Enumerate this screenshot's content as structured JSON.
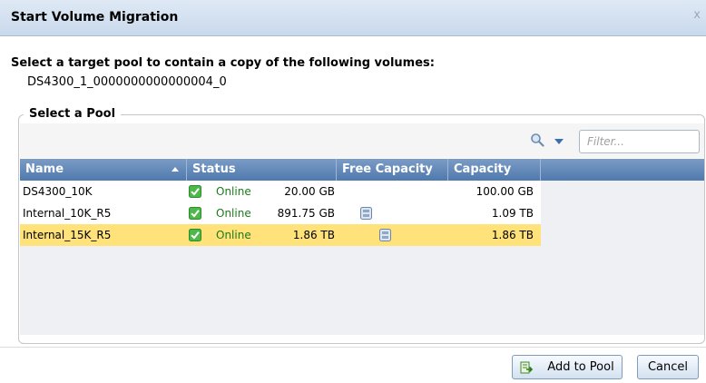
{
  "dialog": {
    "title": "Start Volume Migration",
    "close_label": "x"
  },
  "instruction": "Select a target pool to contain a copy of the following volumes:",
  "volume": "DS4300_1_0000000000000004_0",
  "pool_section": {
    "legend": "Select a Pool",
    "filter_placeholder": "Filter...",
    "icons": {
      "search": "search-icon",
      "menu": "chevron-down-icon"
    }
  },
  "table": {
    "columns": [
      "Name",
      "Status",
      "Free Capacity",
      "Capacity"
    ],
    "rows": [
      {
        "name": "DS4300_10K",
        "status": "Online",
        "free_capacity": "20.00 GB",
        "capacity": "100.00 GB",
        "free_icon": false,
        "selected": false
      },
      {
        "name": "Internal_10K_R5",
        "status": "Online",
        "free_capacity": "891.75 GB",
        "capacity": "1.09 TB",
        "free_icon": true,
        "selected": false
      },
      {
        "name": "Internal_15K_R5",
        "status": "Online",
        "free_capacity": "1.86 TB",
        "capacity": "1.86 TB",
        "free_icon": true,
        "selected": true
      }
    ]
  },
  "buttons": {
    "add": "Add to Pool",
    "cancel": "Cancel"
  },
  "colors": {
    "selected_row": "#ffe27a",
    "header": "#4f79ad",
    "online": "#1c7a1c"
  }
}
